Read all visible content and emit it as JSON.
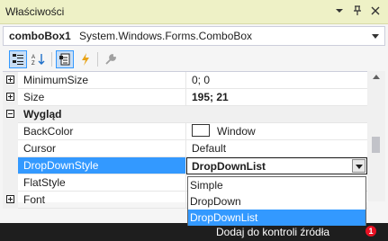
{
  "window": {
    "title": "Właściwości",
    "buttons": [
      {
        "icon": "dropdown-arrow-icon",
        "glyph": "▾"
      },
      {
        "icon": "pin-icon",
        "glyph": "ㅍ"
      },
      {
        "icon": "close-icon",
        "glyph": "✕"
      }
    ]
  },
  "object": {
    "name": "comboBox1",
    "type": "System.Windows.Forms.ComboBox"
  },
  "toolbar": {
    "buttons": [
      {
        "icon": "categorized-icon",
        "pressed": true
      },
      {
        "icon": "alphabetical-icon",
        "pressed": false
      },
      {
        "icon": "properties-icon",
        "pressed": true
      },
      {
        "icon": "events-lightning-icon",
        "pressed": false
      },
      {
        "icon": "property-pages-wrench-icon",
        "pressed": false
      }
    ]
  },
  "properties": [
    {
      "name": "MinimumSize",
      "value": "0; 0",
      "expander": "plus"
    },
    {
      "name": "Size",
      "value": "195; 21",
      "expander": "plus",
      "bold": true
    },
    {
      "name": "Wygląd",
      "category": true
    },
    {
      "name": "BackColor",
      "value": "Window",
      "swatch": "#ffffff"
    },
    {
      "name": "Cursor",
      "value": "Default"
    },
    {
      "name": "DropDownStyle",
      "value": "DropDownList",
      "selected": true
    },
    {
      "name": "FlatStyle",
      "value": ""
    },
    {
      "name": "Font",
      "value": "",
      "expander": "plus"
    }
  ],
  "dropdown": {
    "options": [
      "Simple",
      "DropDown",
      "DropDownList"
    ],
    "selected": "DropDownList"
  },
  "statusbar": {
    "text": "Dodaj do kontroli źródła",
    "notifications": "1"
  },
  "colors": {
    "title_bg": "#eef1c6",
    "selection": "#3399ff",
    "status_bg": "#1e1e1e"
  }
}
